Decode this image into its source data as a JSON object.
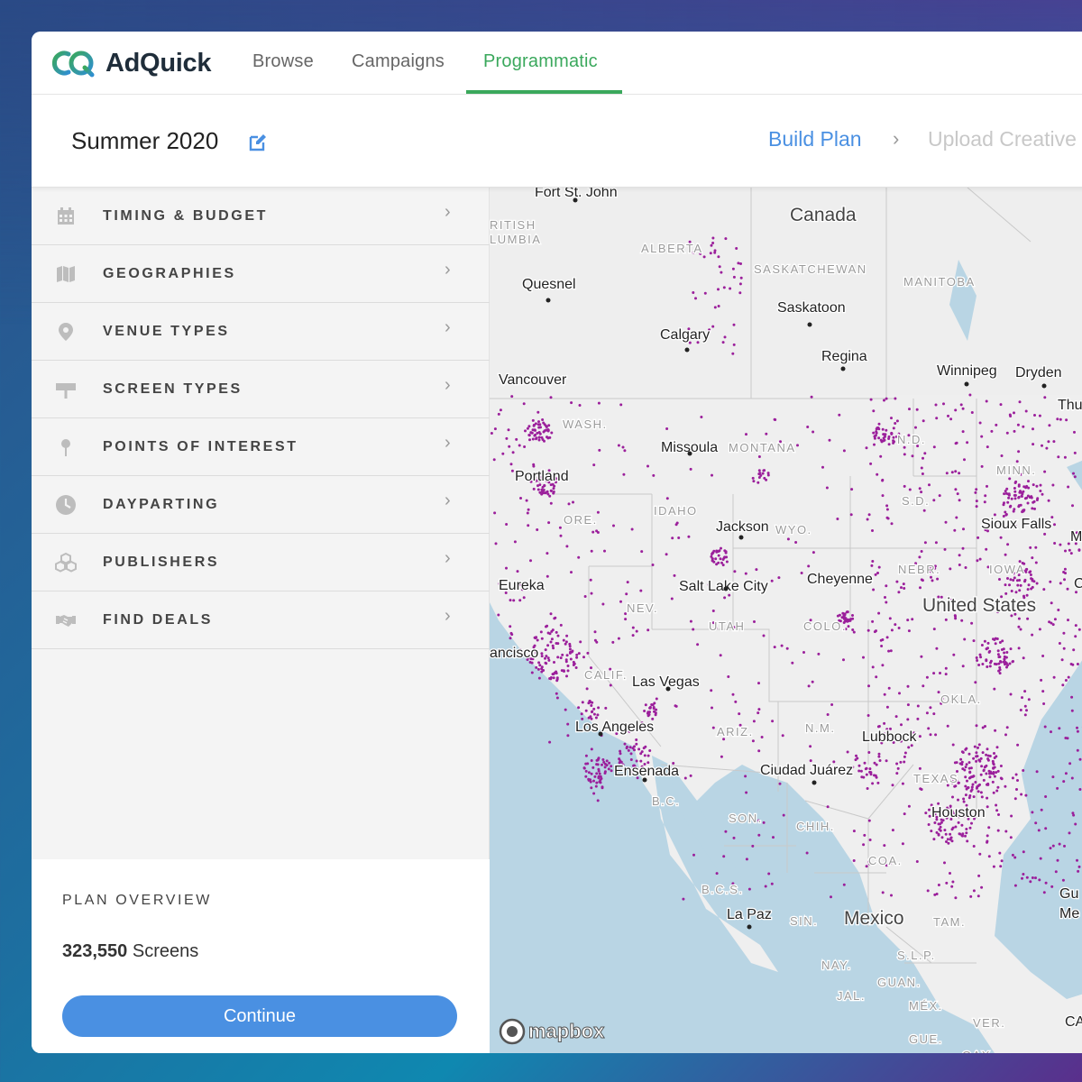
{
  "app": {
    "brand": "AdQuick",
    "nav": [
      {
        "label": "Browse",
        "active": false
      },
      {
        "label": "Campaigns",
        "active": false
      },
      {
        "label": "Programmatic",
        "active": true
      }
    ],
    "accent_color": "#3aa85c",
    "primary_color": "#4a90e2"
  },
  "plan": {
    "title": "Summer 2020",
    "steps": {
      "current": "Build Plan",
      "separator": "›",
      "next": "Upload Creative"
    }
  },
  "sidebar": {
    "items": [
      {
        "label": "TIMING & BUDGET",
        "icon": "calendar-icon"
      },
      {
        "label": "GEOGRAPHIES",
        "icon": "map-icon"
      },
      {
        "label": "VENUE TYPES",
        "icon": "map-pin-icon"
      },
      {
        "label": "SCREEN TYPES",
        "icon": "signboard-icon"
      },
      {
        "label": "POINTS OF INTEREST",
        "icon": "pushpin-icon"
      },
      {
        "label": "DAYPARTING",
        "icon": "clock-icon"
      },
      {
        "label": "PUBLISHERS",
        "icon": "cubes-icon"
      },
      {
        "label": "FIND DEALS",
        "icon": "handshake-icon"
      }
    ],
    "chevron": "›"
  },
  "overview": {
    "title": "PLAN OVERVIEW",
    "count": "323,550",
    "count_unit": "Screens",
    "continue_label": "Continue"
  },
  "map": {
    "attribution": "mapbox",
    "dot_color": "#9b1f9b",
    "labels": {
      "countries": [
        "Canada",
        "United States",
        "Mexico"
      ],
      "regions": [
        "RITISH",
        "LUMBIA",
        "ALBERTA",
        "SASKATCHEWAN",
        "MANITOBA",
        "WASH.",
        "MONTANA",
        "N.D.",
        "S.D.",
        "MINN.",
        "ORE.",
        "IDAHO",
        "WYO.",
        "NEBR.",
        "IOWA",
        "NEV.",
        "UTAH",
        "COLO.",
        "CALIF.",
        "ARIZ.",
        "N.M.",
        "OKLA.",
        "TEXAS",
        "B.C.",
        "SON.",
        "CHIH.",
        "COA.",
        "B.C.S.",
        "SIN.",
        "TAM.",
        "S.L.P.",
        "NAY.",
        "GUAN.",
        "JAL.",
        "MÉX.",
        "VER.",
        "GUE.",
        "OAX."
      ],
      "cities": [
        "Fort St. John",
        "Quesnel",
        "Calgary",
        "Saskatoon",
        "Regina",
        "Winnipeg",
        "Dryden",
        "Thu",
        "Vancouver",
        "Missoula",
        "Portland",
        "Jackson",
        "Sioux Falls",
        "Eureka",
        "Salt Lake City",
        "Cheyenne",
        "ancisco",
        "Las Vegas",
        "Los Angeles",
        "Lubbock",
        "Ensenada",
        "Ciudad Juárez",
        "Houston",
        "La Paz",
        "Gu",
        "Me",
        "CA",
        "M",
        "C"
      ]
    }
  }
}
